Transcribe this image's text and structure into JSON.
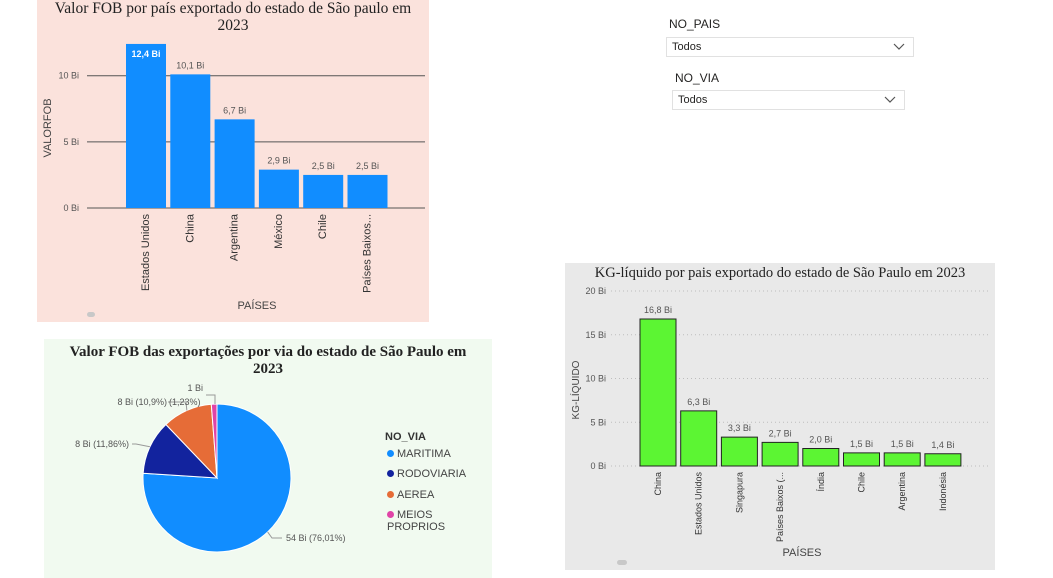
{
  "slicers": {
    "pais": {
      "label": "NO_PAIS",
      "value": "Todos"
    },
    "via": {
      "label": "NO_VIA",
      "value": "Todos"
    }
  },
  "colors": {
    "bar_blue": "#118dff",
    "bar_green": "#5cf533",
    "bg_pink": "#fbe2dc",
    "bg_mint": "#f1faf0",
    "bg_gray": "#e9e9e9",
    "pie_maritima": "#118dff",
    "pie_rodoviaria": "#12239e",
    "pie_aerea": "#e66c37",
    "pie_meios": "#e044a7"
  },
  "chart_data": [
    {
      "type": "bar",
      "title": "Valor FOB por país exportado do estado de São paulo em 2023",
      "xlabel": "PAÍSES",
      "ylabel": "VALORFOB",
      "ylim": [
        0,
        13
      ],
      "yticks": [
        0,
        5,
        10
      ],
      "ytick_labels": [
        "0 Bi",
        "5 Bi",
        "10 Bi"
      ],
      "grid": true,
      "categories": [
        "Estados Unidos",
        "China",
        "Argentina",
        "México",
        "Chile",
        "Países Baixos..."
      ],
      "values": [
        12.4,
        10.1,
        6.7,
        2.9,
        2.5,
        2.5
      ],
      "labels": [
        "12,4 Bi",
        "10,1 Bi",
        "6,7 Bi",
        "2,9 Bi",
        "2,5 Bi",
        "2,5 Bi"
      ]
    },
    {
      "type": "pie",
      "title": "Valor FOB das exportações por via do estado de São Paulo em 2023",
      "legend_title": "NO_VIA",
      "legend_position": "right",
      "slices": [
        {
          "name": "MARITIMA",
          "value": 76.01,
          "label": "54 Bi (76,01%)",
          "color": "#118dff"
        },
        {
          "name": "RODOVIARIA",
          "value": 11.86,
          "label": "8 Bi (11,86%)",
          "color": "#12239e"
        },
        {
          "name": "AEREA",
          "value": 10.9,
          "label": "8 Bi (10,9%)",
          "color": "#e66c37"
        },
        {
          "name": "MEIOS PROPRIOS",
          "value": 1.23,
          "label": "1 Bi",
          "label2": "(1,23%)",
          "color": "#e044a7"
        }
      ]
    },
    {
      "type": "bar",
      "title": "KG-líquido por pais exportado do estado de São Paulo em 2023",
      "xlabel": "PAÍSES",
      "ylabel": "KG-LÍQUIDO",
      "ylim": [
        0,
        20
      ],
      "yticks": [
        0,
        5,
        10,
        15,
        20
      ],
      "ytick_labels": [
        "0 Bi",
        "5 Bi",
        "10 Bi",
        "15 Bi",
        "20 Bi"
      ],
      "grid": true,
      "categories": [
        "China",
        "Estados Unidos",
        "Singapura",
        "Países Baixos (...",
        "Índia",
        "Chile",
        "Argentina",
        "Indonésia"
      ],
      "values": [
        16.8,
        6.3,
        3.3,
        2.7,
        2.0,
        1.5,
        1.5,
        1.4
      ],
      "labels": [
        "16,8 Bi",
        "6,3 Bi",
        "3,3 Bi",
        "2,7 Bi",
        "2,0 Bi",
        "1,5 Bi",
        "1,5 Bi",
        "1,4 Bi"
      ]
    }
  ]
}
